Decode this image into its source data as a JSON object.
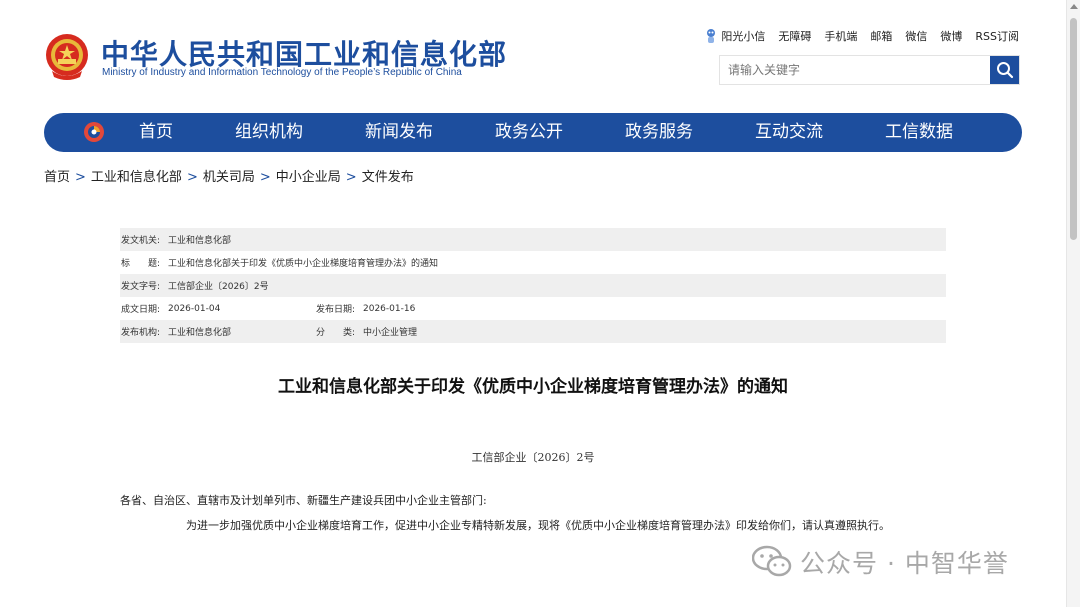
{
  "header": {
    "title_cn": "中华人民共和国工业和信息化部",
    "title_en": "Ministry of Industry and Information Technology of the People’s Republic of China",
    "top_links": [
      "阳光小信",
      "无障碍",
      "手机端",
      "邮箱",
      "微信",
      "微博",
      "RSS订阅"
    ],
    "search_placeholder": "请输入关键字"
  },
  "nav": {
    "items": [
      "首页",
      "组织机构",
      "新闻发布",
      "政务公开",
      "政务服务",
      "互动交流",
      "工信数据"
    ]
  },
  "breadcrumb": [
    "首页",
    "工业和信息化部",
    "机关司局",
    "中小企业局",
    "文件发布"
  ],
  "meta": {
    "issuer_label": "发文机关:",
    "issuer": "工业和信息化部",
    "title_label": "标　　题:",
    "title": "工业和信息化部关于印发《优质中小企业梯度培育管理办法》的通知",
    "doc_no_label": "发文字号:",
    "doc_no": "工信部企业〔2026〕2号",
    "created_label": "成文日期:",
    "created": "2026-01-04",
    "published_label": "发布日期:",
    "published": "2026-01-16",
    "org_label": "发布机构:",
    "org": "工业和信息化部",
    "category_label": "分　　类:",
    "category": "中小企业管理"
  },
  "document": {
    "title": "工业和信息化部关于印发《优质中小企业梯度培育管理办法》的通知",
    "number": "工信部企业〔2026〕2号",
    "addressee": "各省、自治区、直辖市及计划单列市、新疆生产建设兵团中小企业主管部门:",
    "body": "为进一步加强优质中小企业梯度培育工作，促进中小企业专精特新发展，现将《优质中小企业梯度培育管理办法》印发给你们，请认真遵照执行。"
  },
  "watermark": {
    "text": "公众号 · 中智华誉"
  },
  "colors": {
    "brand_blue": "#1d4e9e",
    "meta_shade": "#efefef"
  }
}
